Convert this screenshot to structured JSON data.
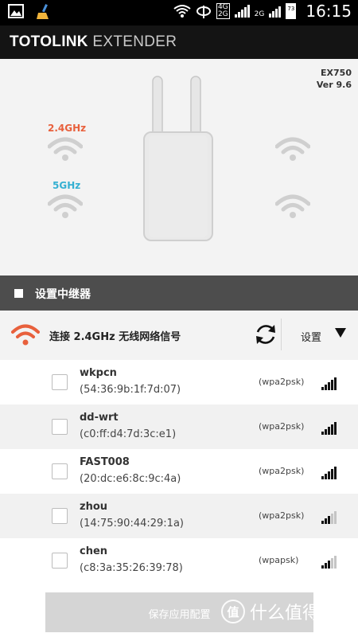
{
  "status_bar": {
    "time": "16:15",
    "network_4g": "4G",
    "network_2g_a": "2G",
    "network_2g_b": "2G",
    "battery": "73",
    "icons": [
      "photo-icon",
      "broom-icon",
      "wifi-icon",
      "carrier-icon",
      "signal-icon",
      "battery-icon"
    ]
  },
  "app": {
    "title_bold": "TOTOLINK",
    "title_light": "EXTENDER"
  },
  "device": {
    "model": "EX750",
    "version": "Ver 9.6",
    "band_24": "2.4GHz",
    "band_5": "5GHz",
    "colors": {
      "band_24": "#e8603c",
      "band_5": "#36b0d2"
    }
  },
  "section": {
    "title": "设置中继器"
  },
  "connect": {
    "label": "连接 2.4GHz 无线网络信号",
    "settings_label": "设置"
  },
  "networks": [
    {
      "ssid": "wkpcn",
      "mac": "(54:36:9b:1f:7d:07)",
      "security": "(wpa2psk)",
      "signal_bars": 5
    },
    {
      "ssid": "dd-wrt",
      "mac": "(c0:ff:d4:7d:3c:e1)",
      "security": "(wpa2psk)",
      "signal_bars": 5
    },
    {
      "ssid": "FAST008",
      "mac": "(20:dc:e6:8c:9c:4a)",
      "security": "(wpa2psk)",
      "signal_bars": 5
    },
    {
      "ssid": "zhou",
      "mac": "(14:75:90:44:29:1a)",
      "security": "(wpa2psk)",
      "signal_bars": 3
    },
    {
      "ssid": "chen",
      "mac": "(c8:3a:35:26:39:78)",
      "security": "(wpapsk)",
      "signal_bars": 3
    }
  ],
  "save": {
    "label": "保存应用配置"
  },
  "watermark": {
    "badge": "值",
    "text": "什么值得买"
  }
}
